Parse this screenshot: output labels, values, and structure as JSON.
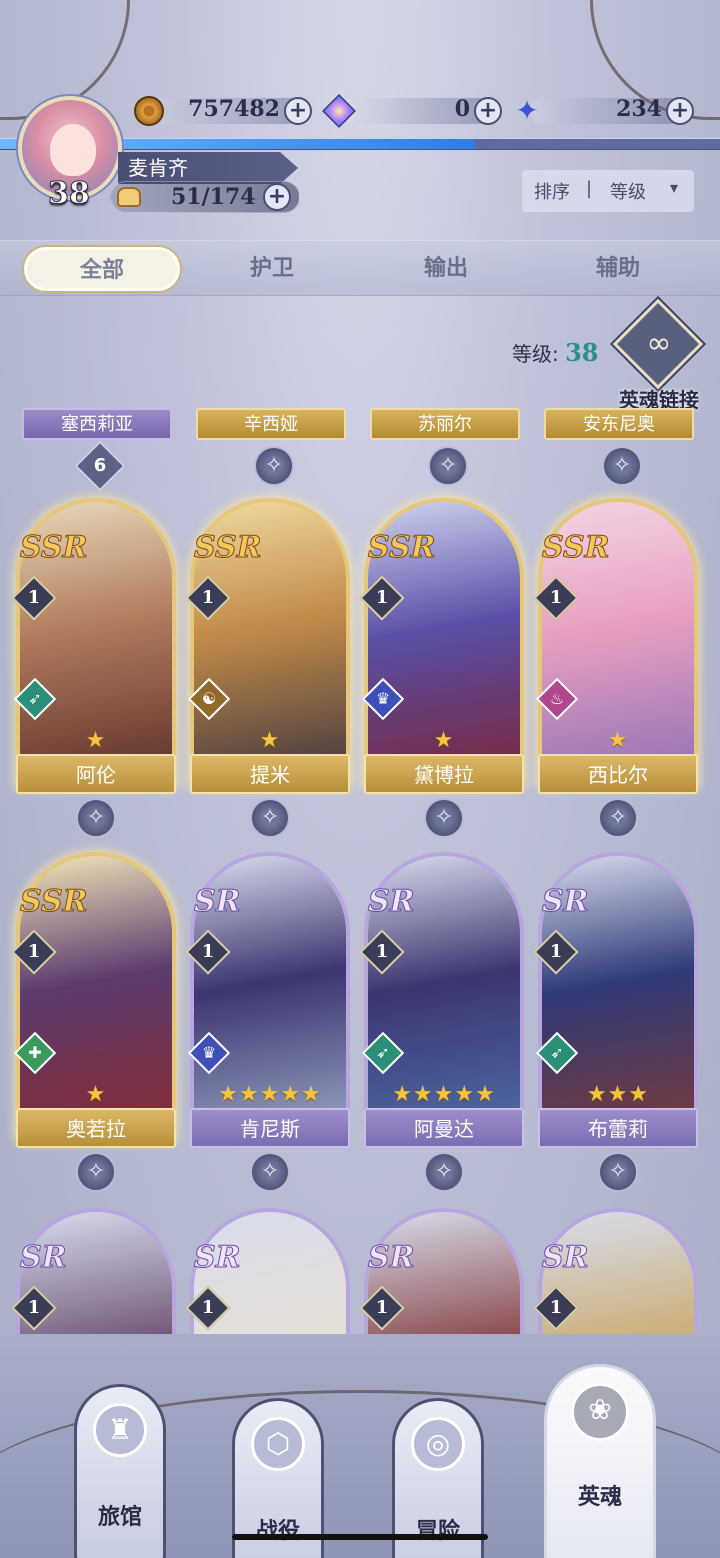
{
  "resources": {
    "gold": "757482",
    "crystal": "0",
    "starstone": "234"
  },
  "player": {
    "name": "麦肯齐",
    "level": "38",
    "stamina": "51/174",
    "xp_progress": 0.66
  },
  "sort": {
    "label": "排序",
    "separator": "|",
    "value": "等级"
  },
  "tabs": [
    "全部",
    "护卫",
    "输出",
    "辅助"
  ],
  "level_filter": {
    "label": "等级:",
    "value": "38"
  },
  "hero_link": {
    "label": "英魂链接"
  },
  "top_row": [
    {
      "name": "塞西莉亚",
      "badge": "6",
      "style": "purple"
    },
    {
      "name": "辛西娅",
      "style": "gold"
    },
    {
      "name": "苏丽尔",
      "style": "gold"
    },
    {
      "name": "安东尼奥",
      "style": "gold"
    }
  ],
  "heroes_row1": [
    {
      "name": "阿伦",
      "rarity": "SSR",
      "level": "1",
      "stars": "★",
      "class_icon": "bow-icon",
      "class_color": "#2b8f7a"
    },
    {
      "name": "提米",
      "rarity": "SSR",
      "level": "1",
      "stars": "★",
      "class_icon": "swirl-icon",
      "class_color": "#8f6a2a"
    },
    {
      "name": "黛博拉",
      "rarity": "SSR",
      "level": "1",
      "stars": "★",
      "class_icon": "tophat-icon",
      "class_color": "#3f4fb8"
    },
    {
      "name": "西比尔",
      "rarity": "SSR",
      "level": "1",
      "stars": "★",
      "class_icon": "potion-icon",
      "class_color": "#b0468c"
    }
  ],
  "heroes_row2": [
    {
      "name": "奥若拉",
      "rarity": "SSR",
      "level": "1",
      "stars": "★",
      "class_icon": "cross-icon",
      "class_color": "#3a9a5c"
    },
    {
      "name": "肯尼斯",
      "rarity": "SR",
      "level": "1",
      "stars": "★★★★★",
      "class_icon": "tophat-icon",
      "class_color": "#3f4fb8"
    },
    {
      "name": "阿曼达",
      "rarity": "SR",
      "level": "1",
      "stars": "★★★★★",
      "class_icon": "bow-icon",
      "class_color": "#2b8f7a"
    },
    {
      "name": "布蕾莉",
      "rarity": "SR",
      "level": "1",
      "stars": "★★★",
      "class_icon": "bow-icon",
      "class_color": "#2b8f7a"
    }
  ],
  "heroes_row3": [
    {
      "rarity": "SR",
      "level": "1"
    },
    {
      "rarity": "SR",
      "level": "1"
    },
    {
      "rarity": "SR",
      "level": "1"
    },
    {
      "rarity": "SR",
      "level": "1"
    }
  ],
  "bottom_nav": [
    {
      "label": "旅馆",
      "icon": "beer-mug-icon"
    },
    {
      "label": "战役",
      "icon": "shield-icon"
    },
    {
      "label": "冒险",
      "icon": "eye-icon"
    },
    {
      "label": "英魂",
      "icon": "rose-icon",
      "active": true
    }
  ],
  "colors": {
    "ssr_gold": "#e5c77a",
    "sr_purple": "#b8a6de",
    "xp_blue": "#2f7ee6"
  }
}
